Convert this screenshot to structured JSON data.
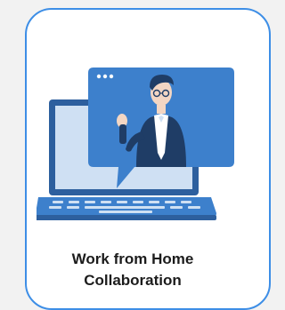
{
  "card": {
    "title_line1": "Work from Home",
    "title_line2": "Collaboration",
    "illustration_icon": "video-call-laptop-icon"
  },
  "colors": {
    "page_background": "#f2f2f2",
    "card_border": "#3d8ee6",
    "illustration_primary": "#3d80cc",
    "illustration_dark": "#2d5f9e",
    "illustration_light": "#cfe0f3"
  }
}
